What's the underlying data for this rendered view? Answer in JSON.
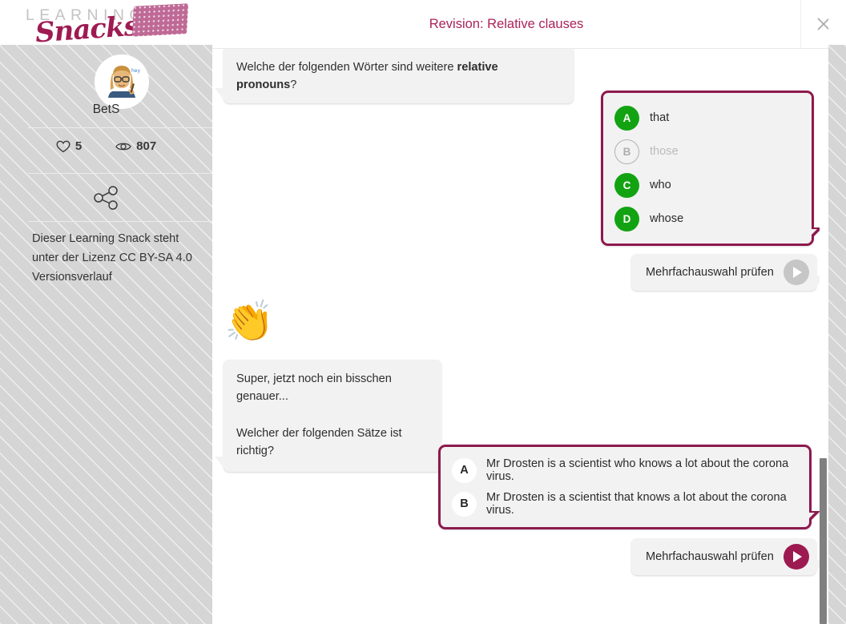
{
  "brand": {
    "logo_line1": "LEARNING",
    "logo_line2": "Snacks",
    "accent_color": "#9e1b52",
    "title_color": "#ab2359",
    "correct_color": "#13a312",
    "card_border_color": "#8d1a4e"
  },
  "header": {
    "title": "Revision: Relative clauses",
    "close_label": "×"
  },
  "sidebar": {
    "author": "BetS",
    "stats": {
      "likes_icon": "heart-icon",
      "likes": "5",
      "views_icon": "eye-icon",
      "views": "807"
    },
    "share_icon": "share-icon",
    "license_line1": "Dieser Learning Snack steht",
    "license_line2": "unter der Lizenz CC BY-SA 4.0",
    "license_line3": "Versionsverlauf"
  },
  "chat": {
    "question1": {
      "text_before": "Welche der folgenden Wörter sind weitere ",
      "text_bold": "relative pronouns",
      "text_after": "?"
    },
    "answers1": [
      {
        "letter": "A",
        "label": "that",
        "state": "correct"
      },
      {
        "letter": "B",
        "label": "those",
        "state": "dimmed"
      },
      {
        "letter": "C",
        "label": "who",
        "state": "correct"
      },
      {
        "letter": "D",
        "label": "whose",
        "state": "correct"
      }
    ],
    "check1": {
      "label": "Mehrfachauswahl prüfen",
      "icon": "play-icon",
      "state": "inactive"
    },
    "clap_emoji": "👏",
    "message2_line1": "Super, jetzt noch ein bisschen genauer...",
    "message2_line2": "Welcher der folgenden Sätze ist richtig?",
    "answers2": [
      {
        "letter": "A",
        "label": "Mr Drosten is a scientist who knows a lot about the corona virus.",
        "state": "unselected"
      },
      {
        "letter": "B",
        "label": "Mr Drosten is a scientist that knows a lot about the corona virus.",
        "state": "unselected"
      }
    ],
    "check2": {
      "label": "Mehrfachauswahl prüfen",
      "icon": "play-icon",
      "state": "active"
    }
  },
  "scrollbar": {
    "name": "vertical-scrollbar"
  }
}
